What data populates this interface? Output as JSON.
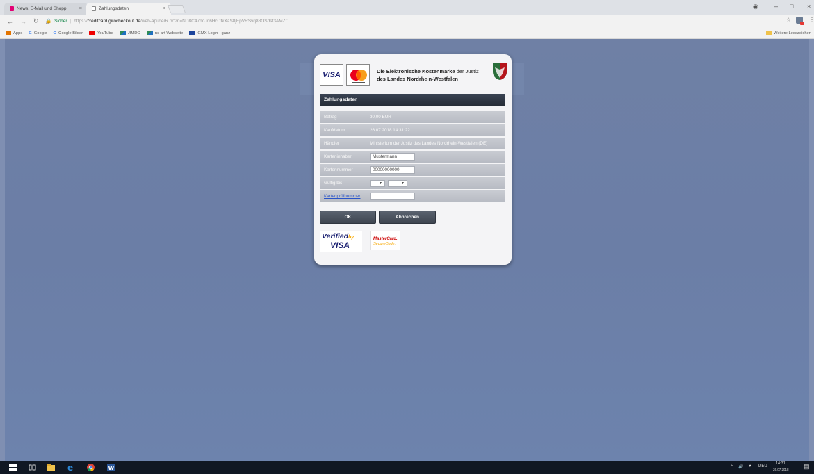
{
  "browser": {
    "tabs": [
      {
        "label": "News, E-Mail und Shopp"
      },
      {
        "label": "Zahlungsdaten"
      }
    ],
    "tab_close": "×",
    "url": {
      "secure_label": "Sicher",
      "scheme": "https://",
      "host": "creditcard.girocheckout.de",
      "path": "/web-api/de/R.po?n=ND8C47noJq6HcDfkXaS8jEpVRSvq88OSdst3AMZC"
    },
    "bookmarks": [
      "Apps",
      "Google",
      "Google Bilder",
      "YouTube",
      "JIMDO",
      "nc-art Webseite",
      "GMX Login - ganz"
    ],
    "other_bookmarks": "Weitere Lesezeichen"
  },
  "dialog": {
    "visa": "VISA",
    "title_bold_1": "Die Elektronische Kostenmarke",
    "title_light_1": " der Justiz",
    "title_line_2": "des Landes Nordrhein-Westfalen",
    "section_header": "Zahlungsdaten",
    "rows": {
      "betrag": {
        "label": "Betrag",
        "value": "30,00 EUR"
      },
      "kaufdatum": {
        "label": "Kaufdatum",
        "value": "26.07.2018 14:31:22"
      },
      "haendler": {
        "label": "Händler",
        "value": "Ministerium der Justiz des Landes Nordrhein-Westfalen (DE)"
      },
      "karteninhaber": {
        "label": "Karteninhaber",
        "value": "Mustermann"
      },
      "kartennummer": {
        "label": "Kartennummer",
        "value": "00000000000"
      },
      "gueltig": {
        "label": "Gültig bis",
        "month": "--",
        "year": "----"
      },
      "pruefnummer": {
        "label": "Kartenprüfnummer",
        "value": ""
      }
    },
    "buttons": {
      "ok": "OK",
      "cancel": "Abbrechen"
    },
    "badges": {
      "vbv_line1": "Verified",
      "vbv_by": "by",
      "vbv_line2": "VISA",
      "mc_line1": "MasterCard.",
      "mc_line2": "SecureCode."
    }
  },
  "taskbar": {
    "language": "DEU",
    "time": "14:31",
    "date": "26.07.2018"
  }
}
